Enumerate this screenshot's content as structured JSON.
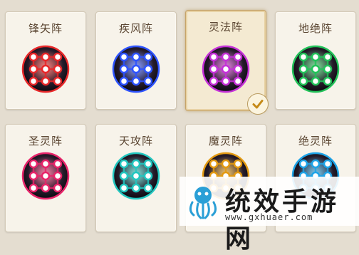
{
  "formations": [
    {
      "name": "锋矢阵",
      "color": "#e8282a",
      "selected": false
    },
    {
      "name": "疾风阵",
      "color": "#2e53ff",
      "selected": false
    },
    {
      "name": "灵法阵",
      "color": "#c531d8",
      "selected": true
    },
    {
      "name": "地绝阵",
      "color": "#23c25a",
      "selected": false
    },
    {
      "name": "圣灵阵",
      "color": "#e8246a",
      "selected": false
    },
    {
      "name": "天攻阵",
      "color": "#22c7c0",
      "selected": false
    },
    {
      "name": "魔灵阵",
      "color": "#e39a12",
      "selected": false
    },
    {
      "name": "绝灵阵",
      "color": "#1ea4e8",
      "selected": false
    }
  ],
  "selected_icon": "checkmark-icon",
  "watermark": {
    "title": "统效手游网",
    "url": "www.gxhuaer.com",
    "logo_icon": "octopus-logo-icon"
  }
}
